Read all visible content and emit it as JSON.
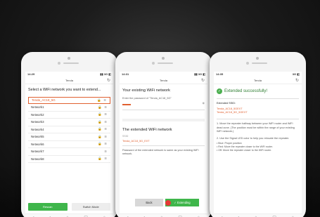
{
  "phone1": {
    "time": "14:29",
    "status_icons": "▮▮ 3G ◧",
    "app_title": "Tenda",
    "prompt": "Select a WiFi network you want to extend...",
    "networks": [
      {
        "name": "Tenda_AC18_5G",
        "icons": "🔒 ᯤ"
      },
      {
        "name": "Network1",
        "icons": "🔒 ᯤ"
      },
      {
        "name": "Network2",
        "icons": "🔒 ᯤ"
      },
      {
        "name": "Network3",
        "icons": "🔒 ᯤ"
      },
      {
        "name": "Network4",
        "icons": "🔒 ᯤ"
      },
      {
        "name": "Network5",
        "icons": "🔒 ᯤ"
      },
      {
        "name": "Network6",
        "icons": "🔒 ᯤ"
      },
      {
        "name": "Network7",
        "icons": "ᯤ"
      },
      {
        "name": "Network8",
        "icons": "🔒 ᯤ"
      }
    ],
    "btn_rescan": "Rescan",
    "btn_switch": "Switch Mode"
  },
  "phone2": {
    "time": "14:31",
    "status_icons": "▮▮ 3G ◧",
    "app_title": "Tenda",
    "heading": "Your existing WiFi network",
    "enter_pw": "Enter the password of \"Tenda_AC18_5G\"",
    "heading2": "The extended WiFi network",
    "ssid_label": "SSID",
    "ssid_value": "Tenda_AC18_5G_EXT",
    "body": "Password of the extended network is same as your existing WiFi network.",
    "btn_back": "Back",
    "btn_extend": "✓ Extending"
  },
  "phone3": {
    "time": "14:35",
    "status_icons": "3G ◧",
    "app_title": "Tenda",
    "success": "Extended successfully!",
    "ssid_label": "Extended SSID:",
    "ssid1": "Tenda_AC18_5GEXT",
    "ssid2": "Tenda_AC18_5G_5GEXT",
    "step1": "1. Move the repeater halfway between your WiFi router and WiFi dead zone. (The position must be within the range of your existing WiFi network.)",
    "step2": "2. Use the Signal LED color to help you relocate the repeater.",
    "bullet1": "• Blue: Proper position",
    "bullet2": "• Red: Move the repeater closer to the WiFi router.",
    "bullet3": "• Off: Move the repeater closer to the WiFi router."
  },
  "nav_icons": [
    "‹",
    "›",
    "⌂",
    "▢",
    "⌂"
  ]
}
